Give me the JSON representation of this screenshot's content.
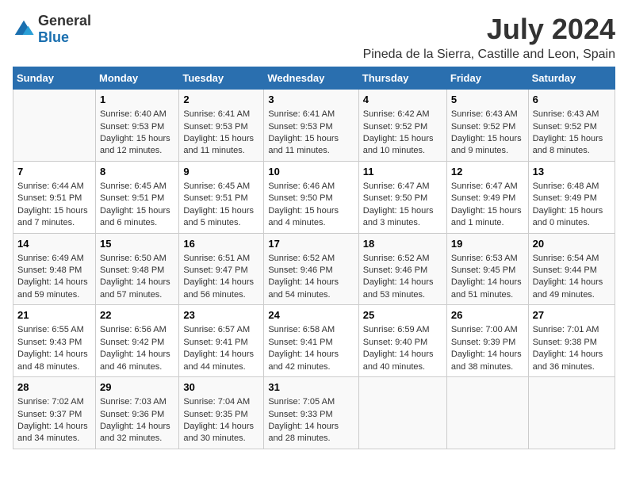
{
  "logo": {
    "general": "General",
    "blue": "Blue"
  },
  "title": "July 2024",
  "subtitle": "Pineda de la Sierra, Castille and Leon, Spain",
  "weekdays": [
    "Sunday",
    "Monday",
    "Tuesday",
    "Wednesday",
    "Thursday",
    "Friday",
    "Saturday"
  ],
  "weeks": [
    [
      {
        "day": "",
        "info": ""
      },
      {
        "day": "1",
        "info": "Sunrise: 6:40 AM\nSunset: 9:53 PM\nDaylight: 15 hours and 12 minutes."
      },
      {
        "day": "2",
        "info": "Sunrise: 6:41 AM\nSunset: 9:53 PM\nDaylight: 15 hours and 11 minutes."
      },
      {
        "day": "3",
        "info": "Sunrise: 6:41 AM\nSunset: 9:53 PM\nDaylight: 15 hours and 11 minutes."
      },
      {
        "day": "4",
        "info": "Sunrise: 6:42 AM\nSunset: 9:52 PM\nDaylight: 15 hours and 10 minutes."
      },
      {
        "day": "5",
        "info": "Sunrise: 6:43 AM\nSunset: 9:52 PM\nDaylight: 15 hours and 9 minutes."
      },
      {
        "day": "6",
        "info": "Sunrise: 6:43 AM\nSunset: 9:52 PM\nDaylight: 15 hours and 8 minutes."
      }
    ],
    [
      {
        "day": "7",
        "info": "Sunrise: 6:44 AM\nSunset: 9:51 PM\nDaylight: 15 hours and 7 minutes."
      },
      {
        "day": "8",
        "info": "Sunrise: 6:45 AM\nSunset: 9:51 PM\nDaylight: 15 hours and 6 minutes."
      },
      {
        "day": "9",
        "info": "Sunrise: 6:45 AM\nSunset: 9:51 PM\nDaylight: 15 hours and 5 minutes."
      },
      {
        "day": "10",
        "info": "Sunrise: 6:46 AM\nSunset: 9:50 PM\nDaylight: 15 hours and 4 minutes."
      },
      {
        "day": "11",
        "info": "Sunrise: 6:47 AM\nSunset: 9:50 PM\nDaylight: 15 hours and 3 minutes."
      },
      {
        "day": "12",
        "info": "Sunrise: 6:47 AM\nSunset: 9:49 PM\nDaylight: 15 hours and 1 minute."
      },
      {
        "day": "13",
        "info": "Sunrise: 6:48 AM\nSunset: 9:49 PM\nDaylight: 15 hours and 0 minutes."
      }
    ],
    [
      {
        "day": "14",
        "info": "Sunrise: 6:49 AM\nSunset: 9:48 PM\nDaylight: 14 hours and 59 minutes."
      },
      {
        "day": "15",
        "info": "Sunrise: 6:50 AM\nSunset: 9:48 PM\nDaylight: 14 hours and 57 minutes."
      },
      {
        "day": "16",
        "info": "Sunrise: 6:51 AM\nSunset: 9:47 PM\nDaylight: 14 hours and 56 minutes."
      },
      {
        "day": "17",
        "info": "Sunrise: 6:52 AM\nSunset: 9:46 PM\nDaylight: 14 hours and 54 minutes."
      },
      {
        "day": "18",
        "info": "Sunrise: 6:52 AM\nSunset: 9:46 PM\nDaylight: 14 hours and 53 minutes."
      },
      {
        "day": "19",
        "info": "Sunrise: 6:53 AM\nSunset: 9:45 PM\nDaylight: 14 hours and 51 minutes."
      },
      {
        "day": "20",
        "info": "Sunrise: 6:54 AM\nSunset: 9:44 PM\nDaylight: 14 hours and 49 minutes."
      }
    ],
    [
      {
        "day": "21",
        "info": "Sunrise: 6:55 AM\nSunset: 9:43 PM\nDaylight: 14 hours and 48 minutes."
      },
      {
        "day": "22",
        "info": "Sunrise: 6:56 AM\nSunset: 9:42 PM\nDaylight: 14 hours and 46 minutes."
      },
      {
        "day": "23",
        "info": "Sunrise: 6:57 AM\nSunset: 9:41 PM\nDaylight: 14 hours and 44 minutes."
      },
      {
        "day": "24",
        "info": "Sunrise: 6:58 AM\nSunset: 9:41 PM\nDaylight: 14 hours and 42 minutes."
      },
      {
        "day": "25",
        "info": "Sunrise: 6:59 AM\nSunset: 9:40 PM\nDaylight: 14 hours and 40 minutes."
      },
      {
        "day": "26",
        "info": "Sunrise: 7:00 AM\nSunset: 9:39 PM\nDaylight: 14 hours and 38 minutes."
      },
      {
        "day": "27",
        "info": "Sunrise: 7:01 AM\nSunset: 9:38 PM\nDaylight: 14 hours and 36 minutes."
      }
    ],
    [
      {
        "day": "28",
        "info": "Sunrise: 7:02 AM\nSunset: 9:37 PM\nDaylight: 14 hours and 34 minutes."
      },
      {
        "day": "29",
        "info": "Sunrise: 7:03 AM\nSunset: 9:36 PM\nDaylight: 14 hours and 32 minutes."
      },
      {
        "day": "30",
        "info": "Sunrise: 7:04 AM\nSunset: 9:35 PM\nDaylight: 14 hours and 30 minutes."
      },
      {
        "day": "31",
        "info": "Sunrise: 7:05 AM\nSunset: 9:33 PM\nDaylight: 14 hours and 28 minutes."
      },
      {
        "day": "",
        "info": ""
      },
      {
        "day": "",
        "info": ""
      },
      {
        "day": "",
        "info": ""
      }
    ]
  ]
}
